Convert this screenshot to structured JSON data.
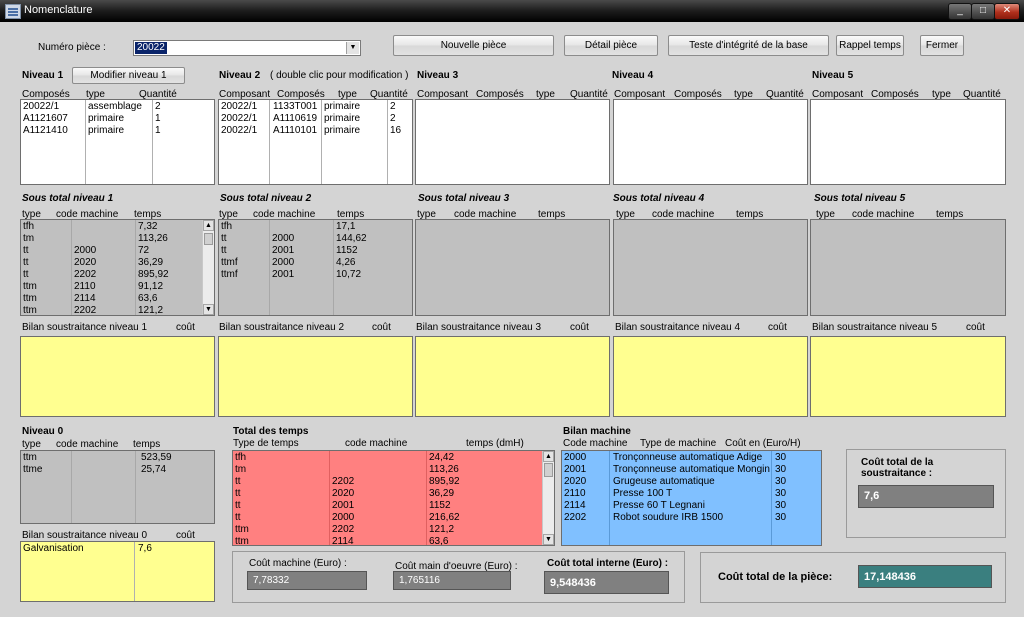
{
  "window": {
    "title": "Nomenclature",
    "minimize": "_",
    "maximize": "□",
    "close": "✕"
  },
  "header": {
    "piece_label": "Numéro pièce :",
    "piece_value": "20022",
    "buttons": [
      "Nouvelle pièce",
      "Détail pièce",
      "Teste d'intégrité de la base",
      "Rappel temps",
      "Fermer"
    ]
  },
  "levels": [
    {
      "title": "Niveau 1",
      "button": "Modifier niveau 1",
      "headers": [
        "Composés",
        "type",
        "Quantité"
      ],
      "rows": [
        [
          "20022/1",
          "assemblage",
          "2"
        ],
        [
          "A1121607",
          "primaire",
          "1"
        ],
        [
          "A1121410",
          "primaire",
          "1"
        ]
      ]
    },
    {
      "title": "Niveau 2",
      "subtitle": "( double clic pour modification )",
      "headers": [
        "Composant",
        "Composés",
        "type",
        "Quantité"
      ],
      "rows": [
        [
          "20022/1",
          "1133T001",
          "primaire",
          "2"
        ],
        [
          "20022/1",
          "A1110619",
          "primaire",
          "2"
        ],
        [
          "20022/1",
          "A1110101",
          "primaire",
          "16"
        ]
      ]
    },
    {
      "title": "Niveau 3",
      "headers": [
        "Composant",
        "Composés",
        "type",
        "Quantité"
      ],
      "rows": []
    },
    {
      "title": "Niveau 4",
      "headers": [
        "Composant",
        "Composés",
        "type",
        "Quantité"
      ],
      "rows": []
    },
    {
      "title": "Niveau 5",
      "headers": [
        "Composant",
        "Composés",
        "type",
        "Quantité"
      ],
      "rows": []
    }
  ],
  "subtotals": [
    {
      "title": "Sous total niveau 1",
      "headers": [
        "type",
        "code machine",
        "temps"
      ],
      "rows": [
        [
          "tfh",
          "",
          "7,32"
        ],
        [
          "tm",
          "",
          "113,26"
        ],
        [
          "tt",
          "2000",
          "72"
        ],
        [
          "tt",
          "2020",
          "36,29"
        ],
        [
          "tt",
          "2202",
          "895,92"
        ],
        [
          "ttm",
          "2110",
          "91,12"
        ],
        [
          "ttm",
          "2114",
          "63,6"
        ],
        [
          "ttm",
          "2202",
          "121,2"
        ]
      ]
    },
    {
      "title": "Sous total niveau 2",
      "headers": [
        "type",
        "code machine",
        "temps"
      ],
      "rows": [
        [
          "tfh",
          "",
          "17,1"
        ],
        [
          "tt",
          "2000",
          "144,62"
        ],
        [
          "tt",
          "2001",
          "1152"
        ],
        [
          "ttmf",
          "2000",
          "4,26"
        ],
        [
          "ttmf",
          "2001",
          "10,72"
        ]
      ]
    },
    {
      "title": "Sous total niveau 3",
      "headers": [
        "type",
        "code machine",
        "temps"
      ],
      "rows": []
    },
    {
      "title": "Sous total niveau 4",
      "headers": [
        "type",
        "code machine",
        "temps"
      ],
      "rows": []
    },
    {
      "title": "Sous total niveau 5",
      "headers": [
        "type",
        "code machine",
        "temps"
      ],
      "rows": []
    }
  ],
  "bilans": [
    {
      "title": "Bilan soustraitance niveau 1",
      "cost": "coût"
    },
    {
      "title": "Bilan soustraitance niveau 2",
      "cost": "coût"
    },
    {
      "title": "Bilan soustraitance niveau 3",
      "cost": "coût"
    },
    {
      "title": "Bilan soustraitance niveau 4",
      "cost": "coût"
    },
    {
      "title": "Bilan soustraitance niveau 5",
      "cost": "coût"
    }
  ],
  "niveau0": {
    "title": "Niveau 0",
    "headers": [
      "type",
      "code machine",
      "temps"
    ],
    "rows": [
      [
        "ttm",
        "",
        "523,59"
      ],
      [
        "ttme",
        "",
        "25,74"
      ]
    ],
    "bilan_title": "Bilan soustraitance niveau 0",
    "bilan_cost": "coût",
    "bilan_rows": [
      [
        "Galvanisation",
        "7,6"
      ]
    ]
  },
  "total_temps": {
    "title": "Total des temps",
    "headers": [
      "Type de temps",
      "code machine",
      "temps (dmH)"
    ],
    "rows": [
      [
        "tfh",
        "",
        "24,42"
      ],
      [
        "tm",
        "",
        "113,26"
      ],
      [
        "tt",
        "2202",
        "895,92"
      ],
      [
        "tt",
        "2020",
        "36,29"
      ],
      [
        "tt",
        "2001",
        "1152"
      ],
      [
        "tt",
        "2000",
        "216,62"
      ],
      [
        "ttm",
        "2202",
        "121,2"
      ],
      [
        "ttm",
        "2114",
        "63,6"
      ]
    ]
  },
  "bilan_machine": {
    "title": "Bilan machine",
    "headers": [
      "Code machine",
      "Type de machine",
      "Coût en (Euro/H)"
    ],
    "rows": [
      [
        "2000",
        "Tronçonneuse automatique Adige",
        "30"
      ],
      [
        "2001",
        "Tronçonneuse automatique Mongin",
        "30"
      ],
      [
        "2020",
        "Grugeuse automatique",
        "30"
      ],
      [
        "2110",
        "Presse 100 T",
        "30"
      ],
      [
        "2114",
        "Presse 60 T Legnani",
        "30"
      ],
      [
        "2202",
        "Robot soudure IRB 1500",
        "30"
      ]
    ]
  },
  "costs": {
    "machine_label": "Coût machine (Euro) :",
    "machine_value": "7,78332",
    "main_label": "Coût main d'oeuvre (Euro) :",
    "main_value": "1,765116",
    "interne_label": "Coût total interne (Euro) :",
    "interne_value": "9,548436",
    "sous_label_1": "Coût total de la",
    "sous_label_2": "soustraitance :",
    "sous_value": "7,6",
    "piece_label": "Coût total de la pièce:",
    "piece_value": "17,148436"
  },
  "icons": {
    "app": "form-icon",
    "dropdown": "chevron-down-icon",
    "scroll_up": "arrow-up-icon",
    "scroll_down": "arrow-down-icon"
  },
  "colors": {
    "grey_list": "#c0c0c0",
    "yellow_list": "#ffff90",
    "red_list": "#ff8080",
    "blue_list": "#80c0ff",
    "output_box": "#808080",
    "teal_box": "#3a7f7f"
  }
}
